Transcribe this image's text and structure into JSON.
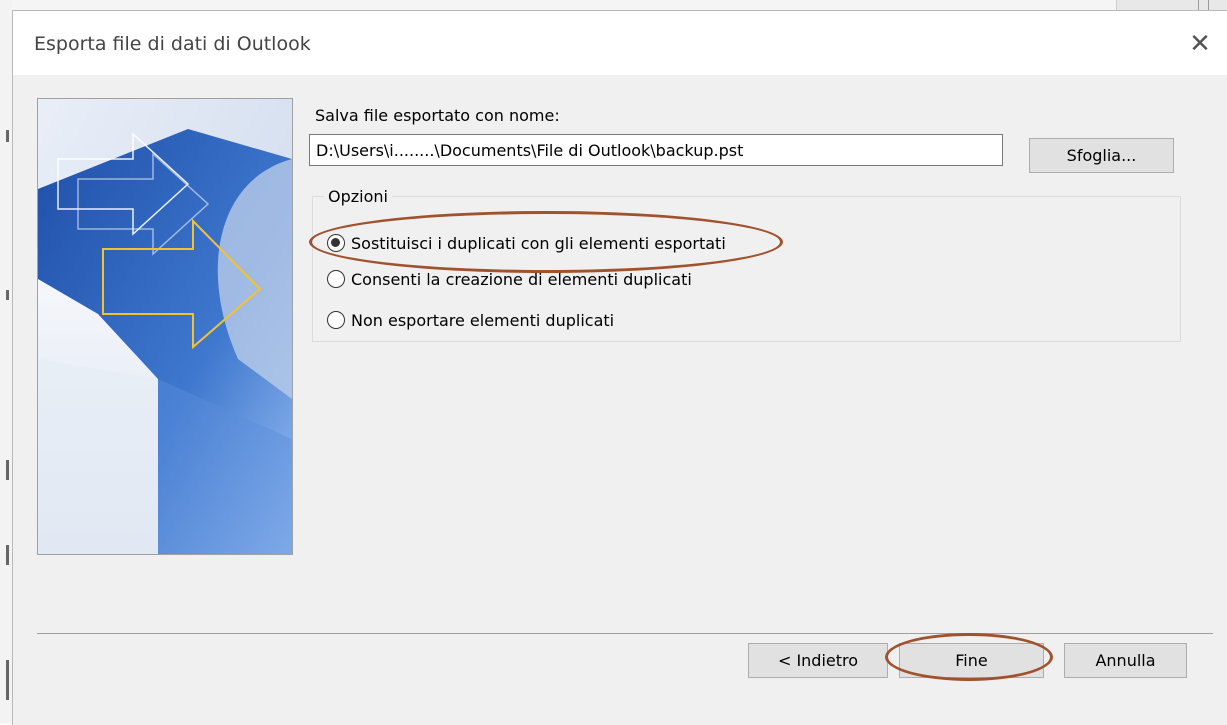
{
  "dialog": {
    "title": "Esporta file di dati di Outlook",
    "close_icon": "close-icon"
  },
  "save": {
    "label": "Salva file esportato con nome:",
    "path_value": "D:\\Users\\i........\\Documents\\File di Outlook\\backup.pst",
    "browse_label": "Sfoglia..."
  },
  "options": {
    "legend": "Opzioni",
    "items": [
      {
        "label": "Sostituisci i duplicati con gli elementi esportati",
        "checked": true
      },
      {
        "label": "Consenti la creazione di elementi duplicati",
        "checked": false
      },
      {
        "label": "Non esportare elementi duplicati",
        "checked": false
      }
    ]
  },
  "footer": {
    "back_label": "< Indietro",
    "finish_label": "Fine",
    "cancel_label": "Annulla"
  },
  "colors": {
    "annotation": "#a0522d",
    "banner_blue": "#3a6fc4",
    "arrow_yellow": "#f2c230"
  }
}
